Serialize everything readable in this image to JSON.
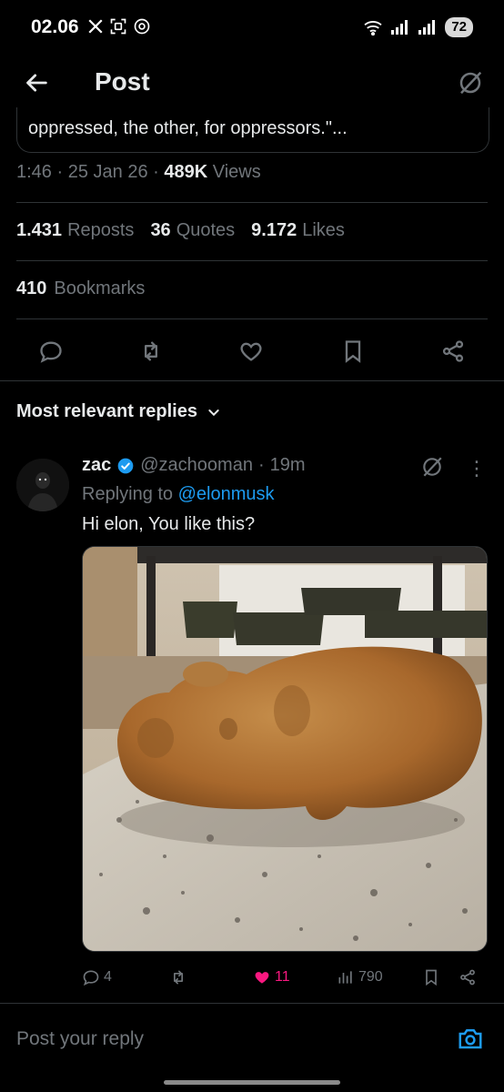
{
  "status_bar": {
    "time": "02.06",
    "battery": "72"
  },
  "header": {
    "title": "Post"
  },
  "post": {
    "quote_snippet": "oppressed, the other, for oppressors.\"...",
    "time": "1:46",
    "date": "25 Jan 26",
    "views_count": "489K",
    "views_label": "Views",
    "reposts_count": "1.431",
    "reposts_label": "Reposts",
    "quotes_count": "36",
    "quotes_label": "Quotes",
    "likes_count": "9.172",
    "likes_label": "Likes",
    "bookmarks_count": "410",
    "bookmarks_label": "Bookmarks"
  },
  "replies_filter": {
    "label": "Most relevant replies"
  },
  "reply": {
    "name": "zac",
    "handle": "@zachooman",
    "age": "19m",
    "replying_prefix": "Replying to",
    "replying_handle": "@elonmusk",
    "text": "Hi elon, You like this?",
    "replies": "4",
    "likes": "11",
    "views": "790"
  },
  "composer": {
    "placeholder": "Post your reply"
  },
  "colors": {
    "accent": "#1d9bf0",
    "like": "#f91880",
    "verified": "#1d9bf0"
  },
  "icons": [
    "back-arrow-icon",
    "grok-icon",
    "reply-icon",
    "repost-icon",
    "like-icon",
    "bookmark-icon",
    "share-icon",
    "chevron-down-icon",
    "verified-icon",
    "more-icon",
    "views-icon",
    "camera-icon"
  ]
}
